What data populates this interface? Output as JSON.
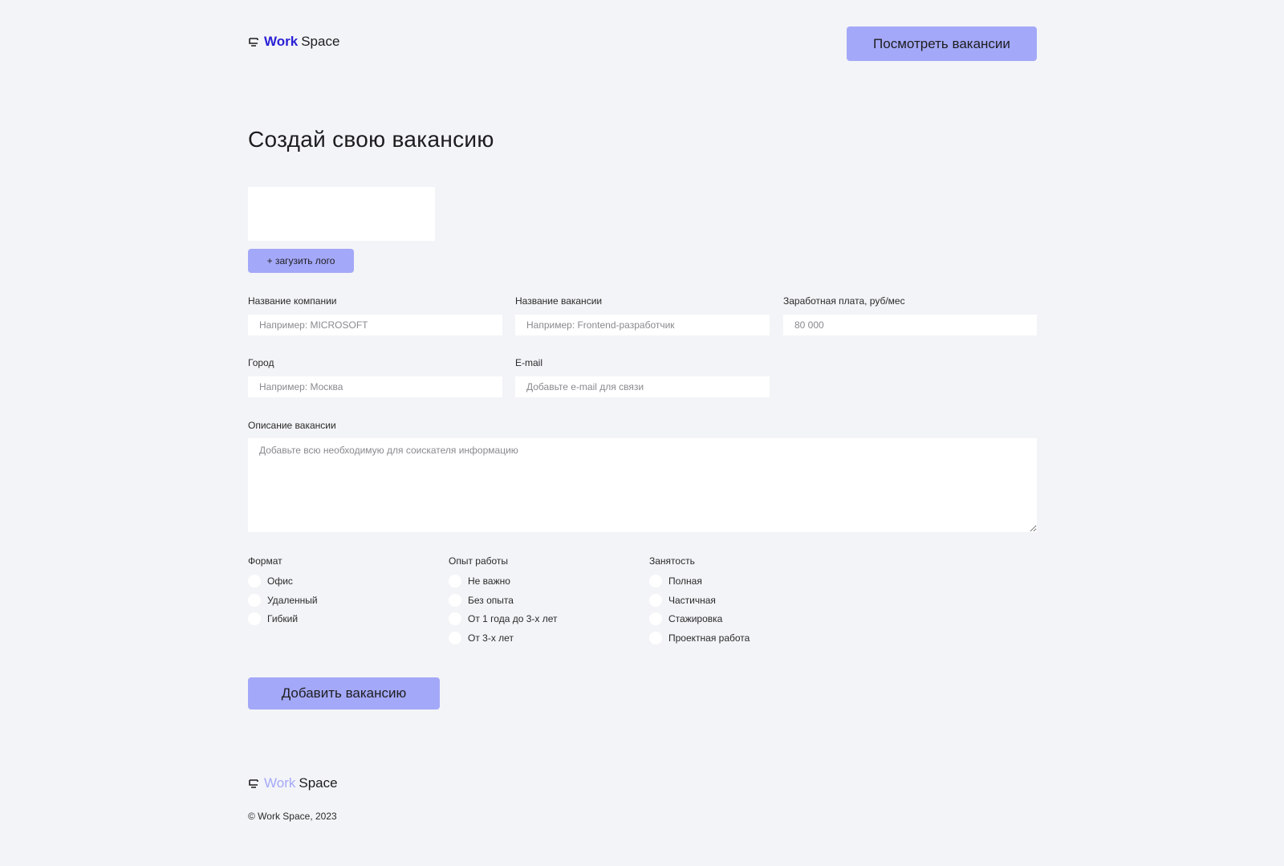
{
  "header": {
    "logo_work": "Work",
    "logo_space": "Space",
    "view_jobs_button": "Посмотреть вакансии"
  },
  "page_title": "Создай свою вакансию",
  "upload_logo_button": "+ загузить лого",
  "fields": {
    "company": {
      "label": "Название компании",
      "placeholder": "Например: MICROSOFT"
    },
    "vacancy": {
      "label": "Название вакансии",
      "placeholder": "Например: Frontend-разработчик"
    },
    "salary": {
      "label": "Заработная плата, руб/мес",
      "placeholder": "80 000"
    },
    "city": {
      "label": "Город",
      "placeholder": "Например: Москва"
    },
    "email": {
      "label": "E-mail",
      "placeholder": "Добавьте e-mail для связи"
    },
    "description": {
      "label": "Описание вакансии",
      "placeholder": "Добавьте всю необходимую для соискателя информацию"
    }
  },
  "groups": {
    "format": {
      "title": "Формат",
      "options": [
        "Офис",
        "Удаленный",
        "Гибкий"
      ]
    },
    "experience": {
      "title": "Опыт работы",
      "options": [
        "Не важно",
        "Без опыта",
        "От 1 года до 3-х лет",
        "От 3-х лет"
      ]
    },
    "employment": {
      "title": "Занятость",
      "options": [
        "Полная",
        "Частичная",
        "Стажировка",
        "Проектная работа"
      ]
    }
  },
  "submit_button": "Добавить вакансию",
  "footer": {
    "logo_work": "Work",
    "logo_space": "Space",
    "copyright": "© Work Space, 2023"
  },
  "colors": {
    "background": "#f3f4f7",
    "accent": "#a4a8f8",
    "brand": "#2b21d6"
  }
}
